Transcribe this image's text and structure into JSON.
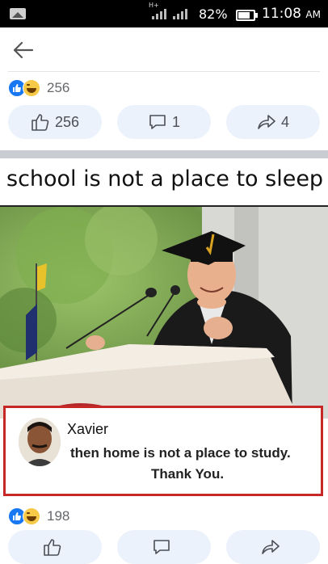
{
  "status_bar": {
    "network_type": "H+",
    "battery_percent": "82%",
    "time": "11:08",
    "time_suffix": "AM"
  },
  "toolbar": {
    "back_icon": "arrow-left-icon"
  },
  "post1": {
    "reaction_icons": [
      "like-icon",
      "haha-icon"
    ],
    "reaction_count": "256",
    "actions": {
      "like_count": "256",
      "comment_count": "1",
      "share_count": "4"
    }
  },
  "post2": {
    "meme": {
      "caption": "school is not a place to sleep",
      "comment_name": "Xavier",
      "comment_line1": "then home is not a place to study.",
      "comment_line2": "Thank You."
    },
    "reaction_icons": [
      "like-icon",
      "haha-icon"
    ],
    "reaction_count": "198",
    "actions": {
      "like_count": "",
      "comment_count": "",
      "share_count": ""
    }
  },
  "colors": {
    "accent_blue": "#1877f2",
    "pill_background": "#ebf2fb",
    "highlight_red": "#c62828",
    "status_bar": "#000000"
  }
}
